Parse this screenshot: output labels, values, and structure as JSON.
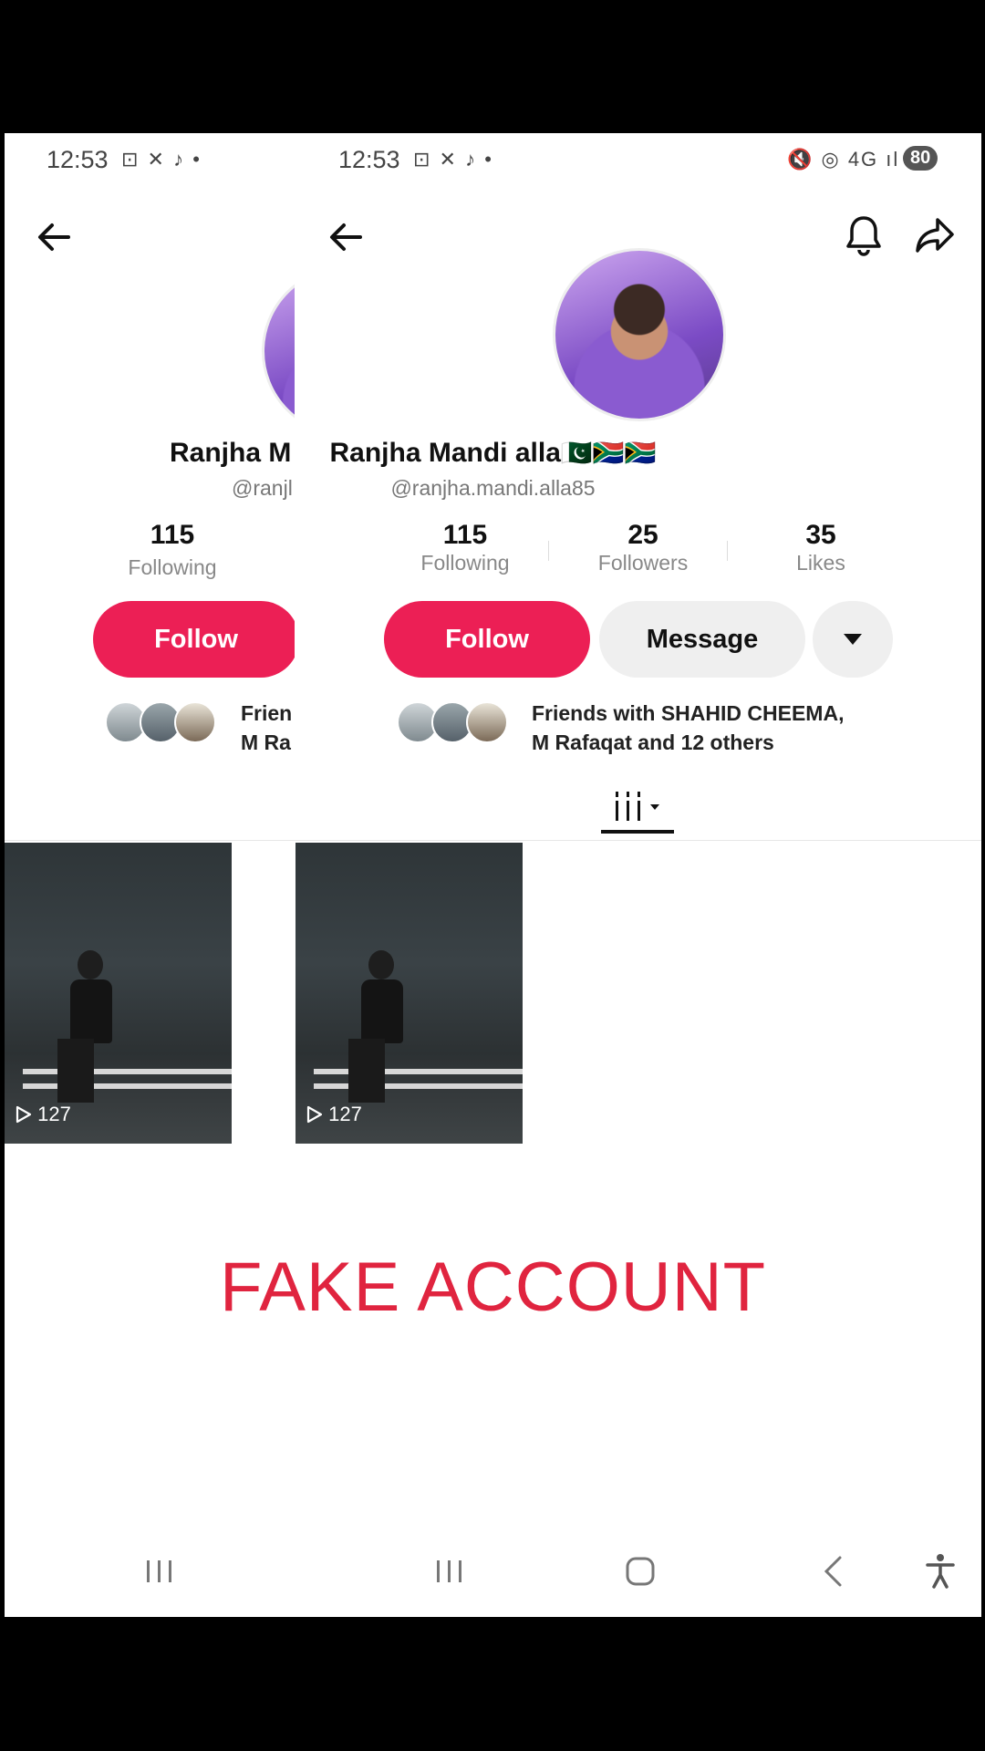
{
  "status_bar": {
    "time": "12:53",
    "left_icons": "⊡ ✕ ♪ •",
    "right_icons": "🔇 ◎ 4G ıl",
    "battery": "80"
  },
  "profile": {
    "name": "Ranjha Mandi alla",
    "flags": "🇵🇰🇿🇦🇿🇦",
    "handle": "@ranjha.mandi.alla85",
    "following_count": "115",
    "following_label": "Following",
    "followers_count": "25",
    "followers_label": "Followers",
    "likes_count": "35",
    "likes_label": "Likes",
    "follow_label": "Follow",
    "message_label": "Message",
    "friends_line1": "Friends with SHAHID CHEEMA,",
    "friends_line2": "M Rafaqat and 12 others"
  },
  "ghost_profile": {
    "name": "Ranjha M",
    "handle": "@ranjl",
    "following_count": "115",
    "following_label": "Following",
    "follow_label": "Follow",
    "friends_line1": "Frien",
    "friends_line2": "M Ra"
  },
  "videos": [
    {
      "views": "127"
    },
    {
      "views": "127"
    }
  ],
  "overlay_text": "FAKE ACCOUNT",
  "icons": {
    "back": "arrow-left-icon",
    "bell": "bell-icon",
    "share": "share-icon",
    "dropdown": "caret-down-icon",
    "grid_tab": "grid-tab-icon",
    "play": "play-icon"
  },
  "colors": {
    "follow": "#ec1f55",
    "fake_text": "#e0243f"
  }
}
